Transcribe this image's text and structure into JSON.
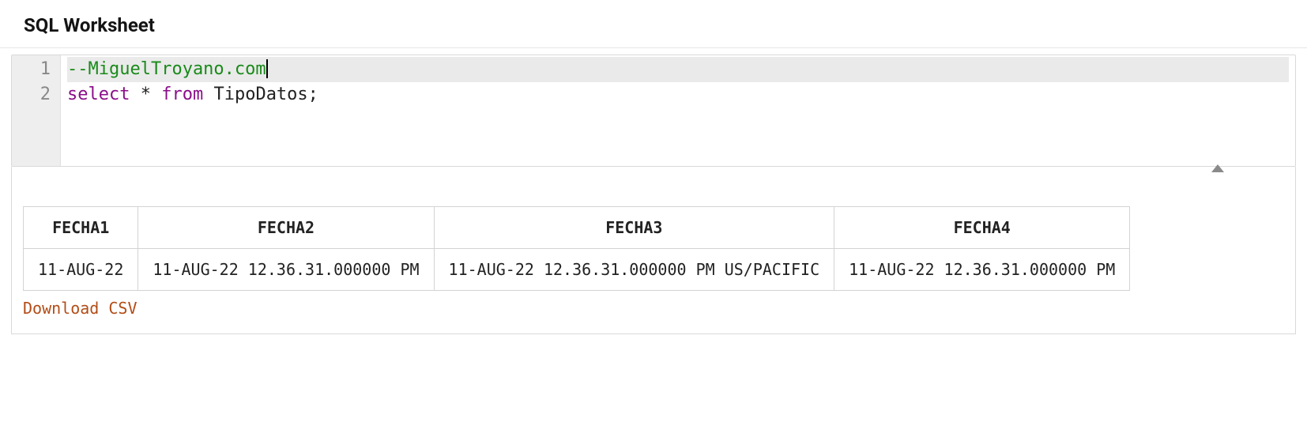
{
  "header": {
    "title": "SQL Worksheet"
  },
  "editor": {
    "line_numbers": [
      "1",
      "2"
    ],
    "lines": {
      "l1": {
        "comment": "--MiguelTroyano.com"
      },
      "l2": {
        "kw1": "select",
        "star": " * ",
        "kw2": "from",
        "rest": " TipoDatos;"
      }
    }
  },
  "results": {
    "headers": [
      "FECHA1",
      "FECHA2",
      "FECHA3",
      "FECHA4"
    ],
    "rows": [
      [
        "11-AUG-22",
        "11-AUG-22 12.36.31.000000 PM",
        "11-AUG-22 12.36.31.000000 PM US/PACIFIC",
        "11-AUG-22 12.36.31.000000 PM"
      ]
    ],
    "download_label": "Download CSV"
  }
}
